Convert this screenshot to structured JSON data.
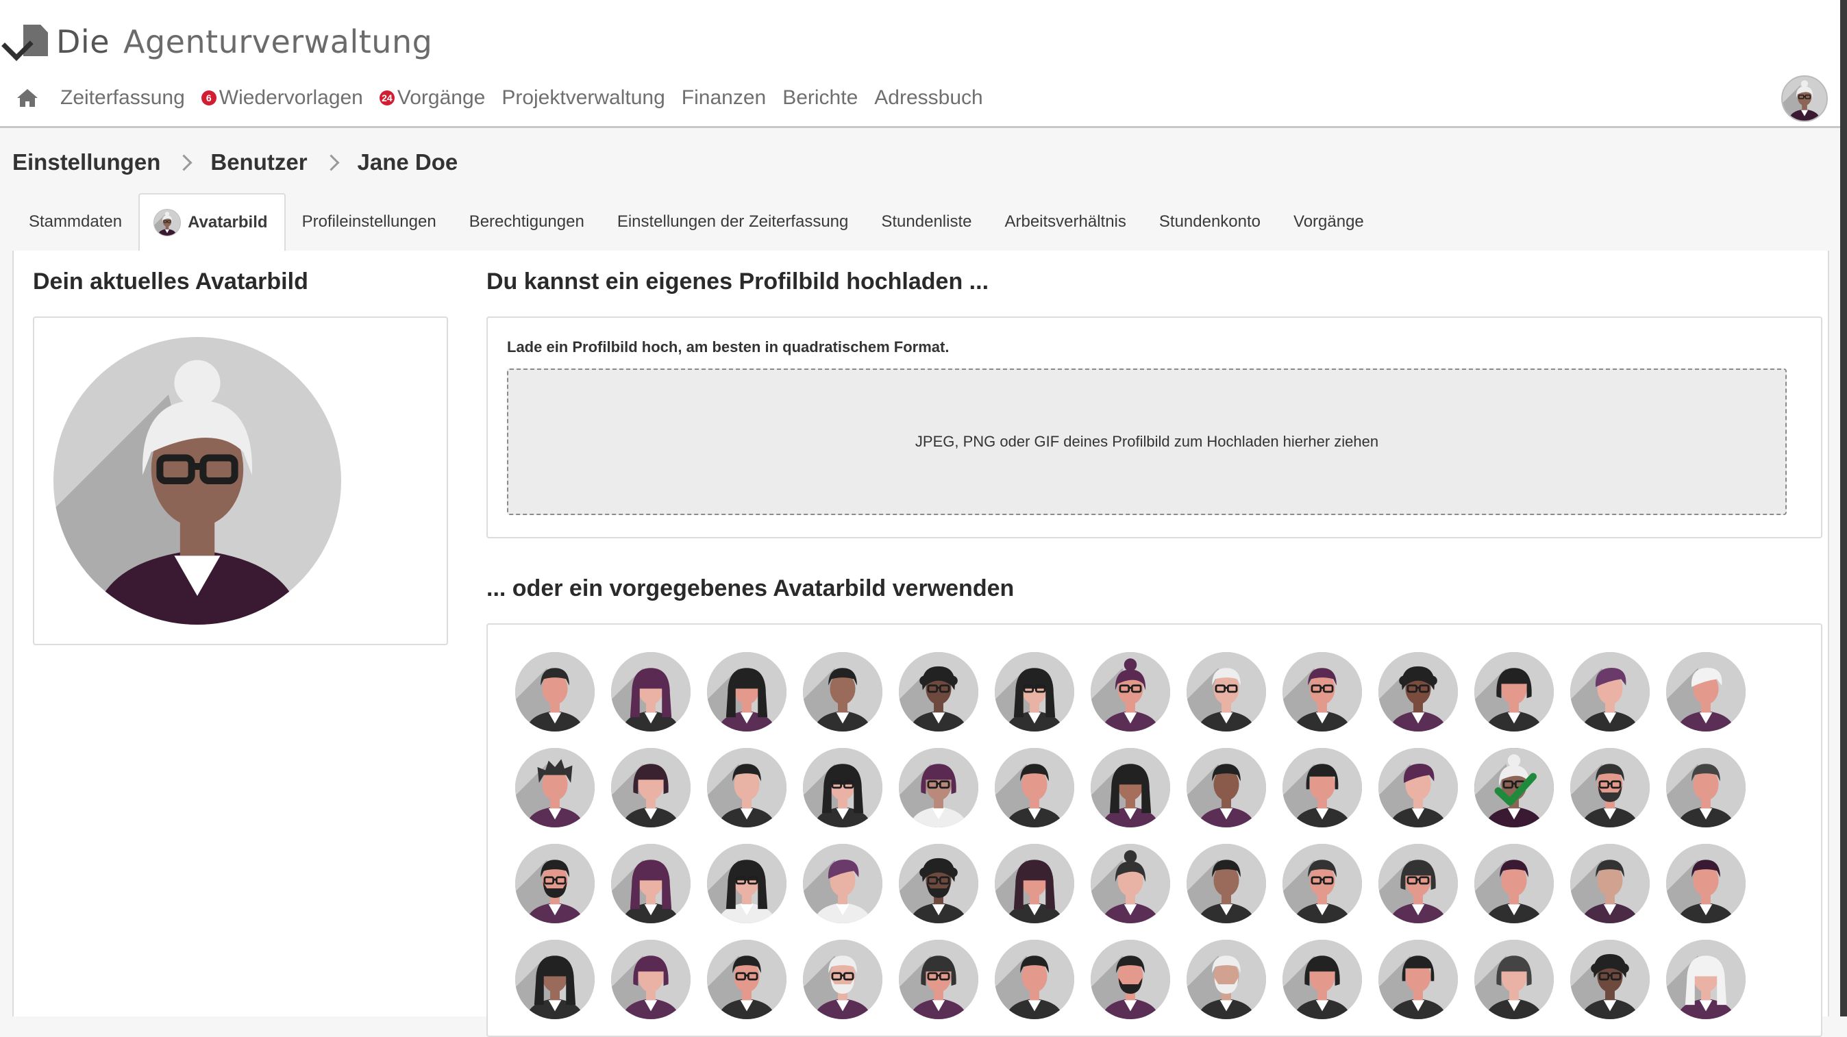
{
  "app": {
    "logo_prefix": "Die",
    "logo_name": "Agenturverwaltung"
  },
  "nav": {
    "home_icon": "home-icon",
    "items": [
      {
        "label": "Zeiterfassung",
        "badge": ""
      },
      {
        "label": "Wiedervorlagen",
        "badge": "6"
      },
      {
        "label": "Vorgänge",
        "badge": "24"
      },
      {
        "label": "Projektverwaltung",
        "badge": ""
      },
      {
        "label": "Finanzen",
        "badge": ""
      },
      {
        "label": "Berichte",
        "badge": ""
      },
      {
        "label": "Adressbuch",
        "badge": ""
      }
    ]
  },
  "breadcrumb": [
    "Einstellungen",
    "Benutzer",
    "Jane Doe"
  ],
  "tabs": [
    {
      "label": "Stammdaten",
      "active": false
    },
    {
      "label": "Avatarbild",
      "active": true
    },
    {
      "label": "Profileinstellungen",
      "active": false
    },
    {
      "label": "Berechtigungen",
      "active": false
    },
    {
      "label": "Einstellungen der Zeiterfassung",
      "active": false
    },
    {
      "label": "Stundenliste",
      "active": false
    },
    {
      "label": "Arbeitsverhältnis",
      "active": false
    },
    {
      "label": "Stundenkonto",
      "active": false
    },
    {
      "label": "Vorgänge",
      "active": false
    }
  ],
  "current": {
    "heading": "Dein aktuelles Avatarbild"
  },
  "upload": {
    "heading": "Du kannst ein eigenes Profilbild hochladen ...",
    "label": "Lade ein Profilbild hoch, am besten in quadratischem Format.",
    "dropzone_text": "JPEG, PNG oder GIF deines Profilbild zum Hochladen hierher ziehen"
  },
  "presets": {
    "heading": "... oder ein vorgegebenes Avatarbild verwenden",
    "selected_index": 23,
    "avatars": [
      {
        "skin": "#e3998b",
        "hair": "#2b2b2b",
        "style": "short",
        "glasses": false,
        "beard": false,
        "cloth": "#2f2f2f"
      },
      {
        "skin": "#eab2a5",
        "hair": "#5a2a52",
        "style": "long",
        "glasses": false,
        "beard": false,
        "cloth": "#2f2f2f"
      },
      {
        "skin": "#e3998b",
        "hair": "#222222",
        "style": "long",
        "glasses": false,
        "beard": false,
        "cloth": "#5b2f55"
      },
      {
        "skin": "#9a6a5b",
        "hair": "#222222",
        "style": "short",
        "glasses": false,
        "beard": false,
        "cloth": "#2f2f2f"
      },
      {
        "skin": "#6e4a3e",
        "hair": "#222222",
        "style": "curly",
        "glasses": true,
        "beard": false,
        "cloth": "#2f2f2f"
      },
      {
        "skin": "#e8b2a4",
        "hair": "#222222",
        "style": "long",
        "glasses": true,
        "beard": false,
        "cloth": "#2f2f2f"
      },
      {
        "skin": "#e3998b",
        "hair": "#5a2a52",
        "style": "bun",
        "glasses": true,
        "beard": false,
        "cloth": "#5b2f55"
      },
      {
        "skin": "#e8b2a4",
        "hair": "#eeeeee",
        "style": "short",
        "glasses": true,
        "beard": false,
        "cloth": "#2f2f2f"
      },
      {
        "skin": "#e3998b",
        "hair": "#5a2a52",
        "style": "short",
        "glasses": true,
        "beard": false,
        "cloth": "#2f2f2f"
      },
      {
        "skin": "#7a4c3e",
        "hair": "#222222",
        "style": "curly",
        "glasses": true,
        "beard": false,
        "cloth": "#5b2f55"
      },
      {
        "skin": "#e3998b",
        "hair": "#222222",
        "style": "bob",
        "glasses": false,
        "beard": false,
        "cloth": "#2f2f2f"
      },
      {
        "skin": "#eab2a5",
        "hair": "#6a3a6a",
        "style": "side",
        "glasses": false,
        "beard": false,
        "cloth": "#2f2f2f"
      },
      {
        "skin": "#e3998b",
        "hair": "#f2f2f2",
        "style": "side",
        "glasses": false,
        "beard": false,
        "cloth": "#5b2f55"
      },
      {
        "skin": "#e3998b",
        "hair": "#333333",
        "style": "messy",
        "glasses": false,
        "beard": false,
        "cloth": "#5b2f55"
      },
      {
        "skin": "#eab2a5",
        "hair": "#3a2230",
        "style": "bob",
        "glasses": false,
        "beard": false,
        "cloth": "#2f2f2f"
      },
      {
        "skin": "#e8b2a4",
        "hair": "#222222",
        "style": "short",
        "glasses": false,
        "beard": false,
        "cloth": "#2f2f2f"
      },
      {
        "skin": "#eab2a5",
        "hair": "#222222",
        "style": "long",
        "glasses": true,
        "beard": false,
        "cloth": "#2f2f2f"
      },
      {
        "skin": "#b98a7c",
        "hair": "#5a2a52",
        "style": "bob",
        "glasses": true,
        "beard": false,
        "cloth": "#eeeeee"
      },
      {
        "skin": "#e3998b",
        "hair": "#222222",
        "style": "short",
        "glasses": false,
        "beard": false,
        "cloth": "#2f2f2f"
      },
      {
        "skin": "#a66f5c",
        "hair": "#222222",
        "style": "long",
        "glasses": false,
        "beard": false,
        "cloth": "#5b2f55"
      },
      {
        "skin": "#8a5a4a",
        "hair": "#222222",
        "style": "short",
        "glasses": false,
        "beard": false,
        "cloth": "#5b2f55"
      },
      {
        "skin": "#e3998b",
        "hair": "#222222",
        "style": "bangs",
        "glasses": false,
        "beard": false,
        "cloth": "#2f2f2f"
      },
      {
        "skin": "#eab2a5",
        "hair": "#5a2a52",
        "style": "side",
        "glasses": false,
        "beard": false,
        "cloth": "#2f2f2f"
      },
      {
        "skin": "#8d6556",
        "hair": "#eeeeee",
        "style": "bun",
        "glasses": true,
        "beard": false,
        "cloth": "#3a1a33"
      },
      {
        "skin": "#e3998b",
        "hair": "#333333",
        "style": "short",
        "glasses": true,
        "beard": true,
        "cloth": "#2f2f2f"
      },
      {
        "skin": "#e3998b",
        "hair": "#444444",
        "style": "short",
        "glasses": false,
        "beard": false,
        "cloth": "#2f2f2f"
      },
      {
        "skin": "#e3998b",
        "hair": "#222222",
        "style": "short",
        "glasses": true,
        "beard": true,
        "cloth": "#5b2f55"
      },
      {
        "skin": "#eab2a5",
        "hair": "#5a2a52",
        "style": "long",
        "glasses": false,
        "beard": false,
        "cloth": "#2f2f2f"
      },
      {
        "skin": "#eab2a5",
        "hair": "#222222",
        "style": "long",
        "glasses": true,
        "beard": false,
        "cloth": "#eeeeee"
      },
      {
        "skin": "#e8b2a4",
        "hair": "#6a3a6a",
        "style": "side",
        "glasses": false,
        "beard": false,
        "cloth": "#eeeeee"
      },
      {
        "skin": "#6e4a3e",
        "hair": "#222222",
        "style": "curly",
        "glasses": true,
        "beard": true,
        "cloth": "#2f2f2f"
      },
      {
        "skin": "#e3998b",
        "hair": "#3a2230",
        "style": "long",
        "glasses": false,
        "beard": false,
        "cloth": "#2f2f2f"
      },
      {
        "skin": "#e8b2a4",
        "hair": "#333333",
        "style": "bun",
        "glasses": false,
        "beard": false,
        "cloth": "#5b2f55"
      },
      {
        "skin": "#9a6a5b",
        "hair": "#222222",
        "style": "short",
        "glasses": false,
        "beard": false,
        "cloth": "#2f2f2f"
      },
      {
        "skin": "#e3998b",
        "hair": "#333333",
        "style": "short",
        "glasses": true,
        "beard": false,
        "cloth": "#2f2f2f"
      },
      {
        "skin": "#e3998b",
        "hair": "#333333",
        "style": "bob",
        "glasses": true,
        "beard": false,
        "cloth": "#5b2f55"
      },
      {
        "skin": "#e3998b",
        "hair": "#3a1a33",
        "style": "short",
        "glasses": false,
        "beard": false,
        "cloth": "#2f2f2f"
      },
      {
        "skin": "#d0a28f",
        "hair": "#333333",
        "style": "short",
        "glasses": false,
        "beard": false,
        "cloth": "#4a2a45"
      },
      {
        "skin": "#e3998b",
        "hair": "#3a1a33",
        "style": "short",
        "glasses": false,
        "beard": false,
        "cloth": "#2f2f2f"
      },
      {
        "skin": "#9a6a5b",
        "hair": "#222222",
        "style": "long",
        "glasses": false,
        "beard": false,
        "cloth": "#2f2f2f"
      },
      {
        "skin": "#eab2a5",
        "hair": "#5a2a52",
        "style": "bob",
        "glasses": false,
        "beard": false,
        "cloth": "#5b2f55"
      },
      {
        "skin": "#e3998b",
        "hair": "#222222",
        "style": "short",
        "glasses": true,
        "beard": false,
        "cloth": "#2f2f2f"
      },
      {
        "skin": "#e8b2a4",
        "hair": "#eeeeee",
        "style": "short",
        "glasses": true,
        "beard": true,
        "cloth": "#5b2f55"
      },
      {
        "skin": "#e3998b",
        "hair": "#333333",
        "style": "bob",
        "glasses": true,
        "beard": false,
        "cloth": "#5b2f55"
      },
      {
        "skin": "#e3998b",
        "hair": "#222222",
        "style": "short",
        "glasses": false,
        "beard": false,
        "cloth": "#2f2f2f"
      },
      {
        "skin": "#e3998b",
        "hair": "#222222",
        "style": "short",
        "glasses": false,
        "beard": true,
        "cloth": "#5b2f55"
      },
      {
        "skin": "#d0a28f",
        "hair": "#eeeeee",
        "style": "short",
        "glasses": false,
        "beard": true,
        "cloth": "#2f2f2f"
      },
      {
        "skin": "#e3998b",
        "hair": "#222222",
        "style": "bob",
        "glasses": false,
        "beard": false,
        "cloth": "#2f2f2f"
      },
      {
        "skin": "#e3998b",
        "hair": "#222222",
        "style": "bangs",
        "glasses": false,
        "beard": false,
        "cloth": "#2f2f2f"
      },
      {
        "skin": "#eab2a5",
        "hair": "#444444",
        "style": "bob",
        "glasses": false,
        "beard": false,
        "cloth": "#2f2f2f"
      },
      {
        "skin": "#6e4a3e",
        "hair": "#222222",
        "style": "curly",
        "glasses": true,
        "beard": false,
        "cloth": "#2f2f2f"
      },
      {
        "skin": "#eab2a5",
        "hair": "#f2f2f2",
        "style": "long",
        "glasses": false,
        "beard": false,
        "cloth": "#5b2f55"
      }
    ]
  },
  "colors": {
    "badge": "#d11e33",
    "selected_ring": "#1f8a3c",
    "current_skin": "#8d6556",
    "current_hair": "#eeeeee",
    "current_cloth": "#3a1a33"
  }
}
